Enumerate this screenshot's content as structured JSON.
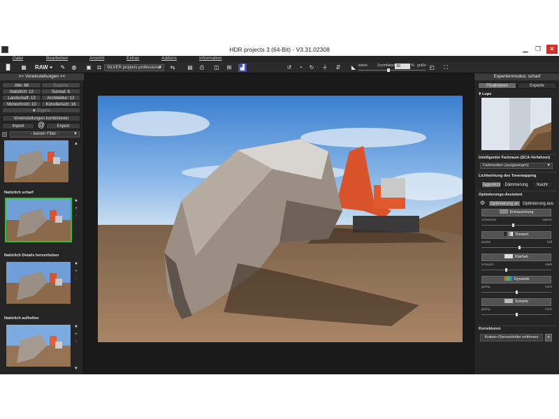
{
  "window": {
    "title": "HDR projects 3 (64-Bit) - V3.31.02308",
    "min_icon": "minimize-icon",
    "max_icon": "maximize-icon",
    "close_icon": "close-icon"
  },
  "menu": [
    "Datei",
    "Bearbeiten",
    "Ansicht",
    "Extras",
    "Addons",
    "Information"
  ],
  "toolbar": {
    "raw_label": "RAW",
    "preset_value": "SILVER projects professional",
    "zoom_small_label": "kleine",
    "zoom_factor_label": "Zoomfaktor",
    "zoom_large_label": "größe",
    "zoom_value": "30",
    "zoom_pct": "%",
    "zoom_level": 0.45
  },
  "left": {
    "header": ">> Voreinstellungen <<",
    "categories": [
      {
        "label": "Alle: 68",
        "active": true
      },
      {
        "label": "Experte",
        "active": false
      },
      {
        "label": "Natürlich: 12",
        "active": true
      },
      {
        "label": "Surreal: 6",
        "active": true
      },
      {
        "label": "Landschaft: 12",
        "active": true
      },
      {
        "label": "Architektur: 12",
        "active": true
      },
      {
        "label": "Monochrom: 10",
        "active": true
      },
      {
        "label": "Künstlerisch: 16",
        "active": true
      },
      {
        "label": "Eigene",
        "active": false
      }
    ],
    "combine_label": "Voreinstellungen kombinieren",
    "import_label": "Import",
    "export_label": "Export",
    "filter_value": "- keinen Filter -",
    "thumbs": [
      {
        "label": "",
        "selected": false
      },
      {
        "label": "Natürlich scharf",
        "selected": true
      },
      {
        "label": "Natürlich Details hervorheben",
        "selected": false
      },
      {
        "label": "Natürlich aufhellen",
        "selected": false
      }
    ]
  },
  "right": {
    "header": "Expertenmodus: scharf",
    "tab_finalize": "Finalisieren",
    "tab_expert": "Experte",
    "lupe_title": "Lupe",
    "colorspace_title": "Intelligenter Farbraum (SCA-Verfahren)",
    "colorspace_value": "Farbmedien (ausgewogen)",
    "light_title": "Lichtwirkung des Tonemapping",
    "light_options": [
      "Tageslicht",
      "Dämmerung",
      "Nacht"
    ],
    "assist_title": "Optimierungs-Assistent",
    "assist_on": "Optimierung an",
    "assist_off": "Optimierung aus",
    "adjustments": [
      {
        "label": "Entrauschung",
        "left": "schwächer",
        "right": "stärker",
        "value": 0.45
      },
      {
        "label": "Tonwert",
        "left": "dunkel",
        "right": "hell",
        "value": 0.55
      },
      {
        "label": "Klarheit",
        "left": "schwach",
        "right": "stark",
        "value": 0.35
      },
      {
        "label": "Dynamik",
        "left": "gering",
        "right": "hoch",
        "value": 0.5
      },
      {
        "label": "Schärfe",
        "left": "gering",
        "right": "hoch",
        "value": 0.5
      }
    ],
    "corrections_title": "Korrekturen",
    "corrections_button": "Kratzer-/Sensorfehler entfernen",
    "corrections_plus": "+"
  }
}
